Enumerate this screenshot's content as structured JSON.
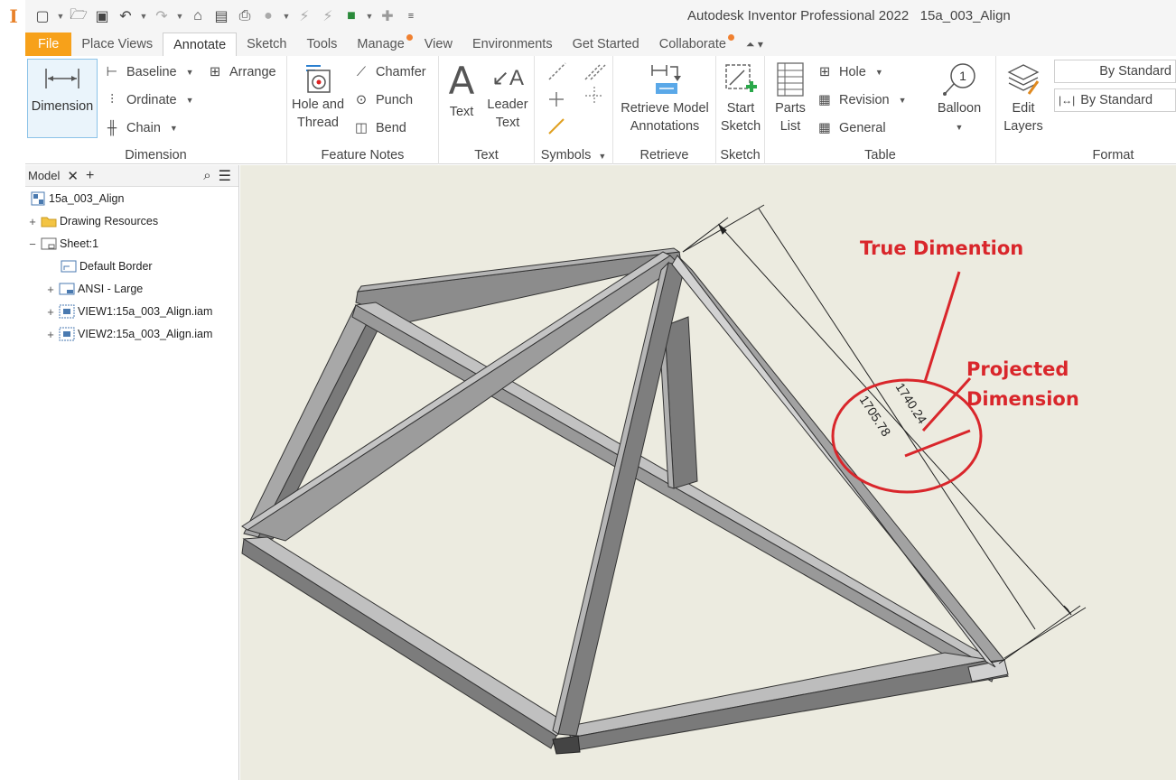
{
  "app": {
    "title": "Autodesk Inventor Professional 2022",
    "document": "15a_003_Align"
  },
  "tabs": [
    {
      "label": "File"
    },
    {
      "label": "Place Views"
    },
    {
      "label": "Annotate"
    },
    {
      "label": "Sketch"
    },
    {
      "label": "Tools"
    },
    {
      "label": "Manage"
    },
    {
      "label": "View"
    },
    {
      "label": "Environments"
    },
    {
      "label": "Get Started"
    },
    {
      "label": "Collaborate"
    }
  ],
  "ribbon": {
    "dimension_panel": {
      "title": "Dimension",
      "dimension": "Dimension",
      "baseline": "Baseline",
      "ordinate": "Ordinate",
      "chain": "Chain",
      "arrange": "Arrange"
    },
    "feature_notes_panel": {
      "title": "Feature Notes",
      "hole_line1": "Hole and",
      "hole_line2": "Thread",
      "chamfer": "Chamfer",
      "punch": "Punch",
      "bend": "Bend"
    },
    "text_panel": {
      "title": "Text",
      "text": "Text",
      "leader_line1": "Leader",
      "leader_line2": "Text"
    },
    "symbols_panel": {
      "title": "Symbols"
    },
    "retrieve_panel": {
      "title": "Retrieve",
      "line1": "Retrieve Model",
      "line2": "Annotations"
    },
    "sketch_panel": {
      "title": "Sketch",
      "line1": "Start",
      "line2": "Sketch"
    },
    "table_panel": {
      "title": "Table",
      "parts_line1": "Parts",
      "parts_line2": "List",
      "hole": "Hole",
      "revision": "Revision",
      "general": "General"
    },
    "balloon": {
      "label": "Balloon",
      "number": "1"
    },
    "layers": {
      "line1": "Edit",
      "line2": "Layers"
    },
    "format_panel": {
      "title": "Format",
      "style1": "By Standard",
      "style2": "By Standard"
    }
  },
  "browser": {
    "tab": "Model",
    "nodes": [
      {
        "label": "15a_003_Align"
      },
      {
        "label": "Drawing Resources"
      },
      {
        "label": "Sheet:1"
      },
      {
        "label": "Default Border"
      },
      {
        "label": "ANSI - Large"
      },
      {
        "label": "VIEW1:15a_003_Align.iam"
      },
      {
        "label": "VIEW2:15a_003_Align.iam"
      }
    ]
  },
  "canvas": {
    "true_dim_value": "1740.24",
    "projected_dim_value": "1705.78",
    "annotation_true": "True Dimention",
    "annotation_projected_line1": "Projected",
    "annotation_projected_line2": "Dimension",
    "annotation_color": "#d9262b"
  },
  "colors": {
    "file_tab": "#f7a11a",
    "canvas_bg": "#ecebe0",
    "frame_dark": "#6d6d6d",
    "frame_light": "#b8b8b8"
  }
}
